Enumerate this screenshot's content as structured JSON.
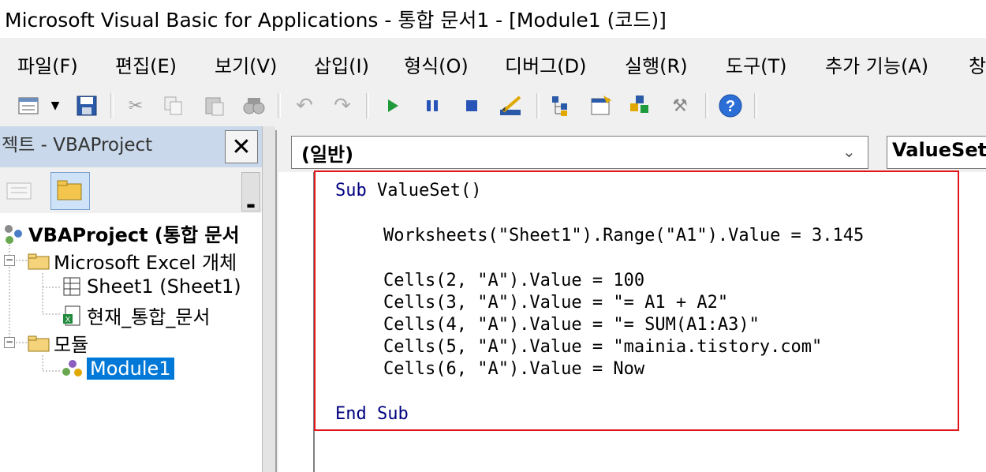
{
  "window": {
    "title": "Microsoft Visual Basic for Applications - 통합 문서1 - [Module1 (코드)]"
  },
  "menu": [
    {
      "label": "파일(F)"
    },
    {
      "label": "편집(E)"
    },
    {
      "label": "보기(V)"
    },
    {
      "label": "삽입(I)"
    },
    {
      "label": "형식(O)"
    },
    {
      "label": "디버그(D)"
    },
    {
      "label": "실행(R)"
    },
    {
      "label": "도구(T)"
    },
    {
      "label": "추가 기능(A)"
    },
    {
      "label": "창"
    }
  ],
  "toolbar_icons": [
    "view-excel-icon",
    "insert-userform-icon",
    "save-icon",
    "cut-icon",
    "copy-icon",
    "paste-icon",
    "find-icon",
    "undo-icon",
    "redo-icon",
    "run-icon",
    "break-icon",
    "reset-icon",
    "design-mode-icon",
    "project-explorer-icon",
    "properties-icon",
    "object-browser-icon",
    "toolbox-icon",
    "help-icon"
  ],
  "project": {
    "title": "젝트 - VBAProject",
    "close": "✕",
    "tree": [
      {
        "label": "VBAProject (통합 문서"
      },
      {
        "label": "Microsoft Excel 개체"
      },
      {
        "label": "Sheet1 (Sheet1)"
      },
      {
        "label": "현재_통합_문서"
      },
      {
        "label": "모듈"
      },
      {
        "label": "Module1"
      }
    ]
  },
  "code": {
    "object_combo": "(일반)",
    "proc_combo": "ValueSet",
    "lines": {
      "l1_kw": "Sub",
      "l1_rest": " ValueSet()",
      "l2": "Worksheets(\"Sheet1\").Range(\"A1\").Value = 3.145",
      "l3": "Cells(2, \"A\").Value = 100",
      "l4": "Cells(3, \"A\").Value = \"= A1 + A2\"",
      "l5": "Cells(4, \"A\").Value = \"= SUM(A1:A3)\"",
      "l6": "Cells(5, \"A\").Value = \"mainia.tistory.com\"",
      "l7": "Cells(6, \"A\").Value = Now",
      "l8_kw": "End Sub"
    }
  },
  "colors": {
    "keyword": "#00007f",
    "highlight": "#e0161b",
    "selected": "#0078d7"
  }
}
